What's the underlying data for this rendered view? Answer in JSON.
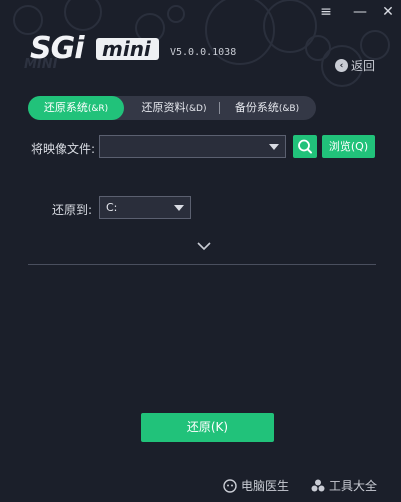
{
  "window": {
    "menu_icon": "≡",
    "minimize_icon": "—",
    "close_icon": "✕"
  },
  "logo": {
    "brand": "SGi",
    "product": "mini",
    "watermark": "MINI"
  },
  "version": "V5.0.0.1038",
  "back_label": "返回",
  "tabs": [
    {
      "label": "还原系统",
      "hotkey": "(&R)",
      "active": true
    },
    {
      "label": "还原资料",
      "hotkey": "(&D)",
      "active": false
    },
    {
      "label": "备份系统",
      "hotkey": "(&B)",
      "active": false
    }
  ],
  "image_file": {
    "label": "将映像文件:",
    "value": "",
    "browse_label": "浏览(Q)"
  },
  "restore_to": {
    "label": "还原到:",
    "value": "C:"
  },
  "restore_button": "还原(K)",
  "footer": {
    "pc_doctor": "电脑医生",
    "toolbox": "工具大全"
  },
  "colors": {
    "accent": "#21c27a",
    "background": "#1b1f2a"
  }
}
